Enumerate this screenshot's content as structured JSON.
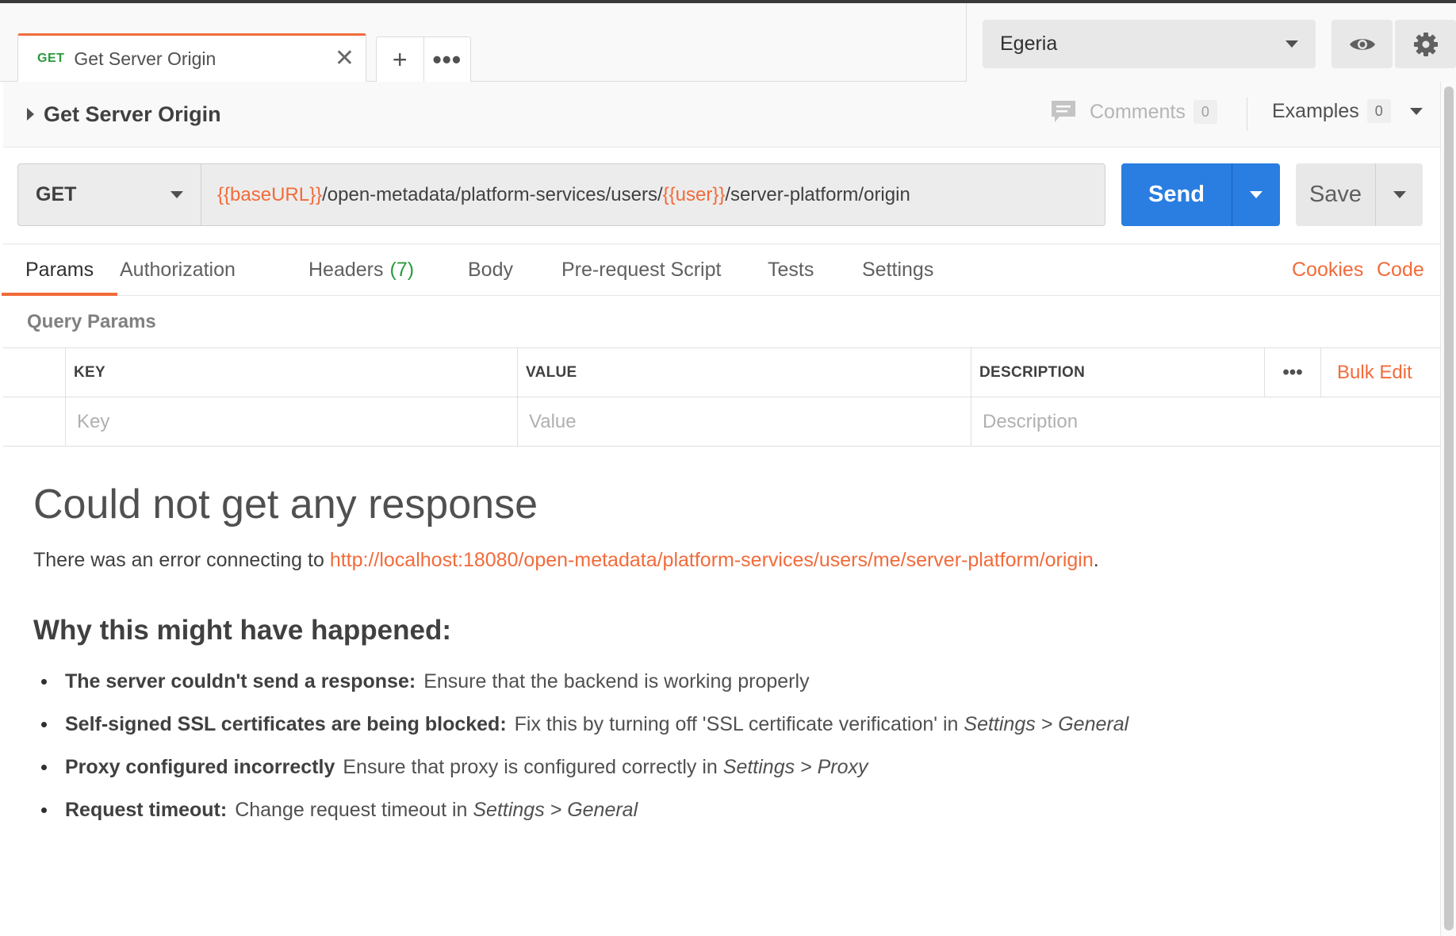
{
  "tabs": [
    {
      "method": "GET",
      "name": "Get Server Origin",
      "close": "✕"
    }
  ],
  "tab_actions": {
    "add": "+",
    "more": "•••"
  },
  "environment": {
    "selected": "Egeria"
  },
  "request": {
    "title": "Get Server Origin",
    "comments_label": "Comments",
    "comments_count": "0",
    "examples_label": "Examples",
    "examples_count": "0",
    "method": "GET",
    "url": {
      "var1": "{{baseURL}}",
      "mid": "/open-metadata/platform-services/users/",
      "var2": "{{user}}",
      "tail": "/server-platform/origin"
    },
    "send_label": "Send",
    "save_label": "Save"
  },
  "subtabs": {
    "params": "Params",
    "authorization": "Authorization",
    "headers": "Headers",
    "headers_count": "(7)",
    "body": "Body",
    "prerequest": "Pre-request Script",
    "tests": "Tests",
    "settings": "Settings",
    "cookies": "Cookies",
    "code": "Code"
  },
  "query_params": {
    "title": "Query Params",
    "col_key": "KEY",
    "col_value": "VALUE",
    "col_description": "DESCRIPTION",
    "more": "•••",
    "bulk_edit": "Bulk Edit",
    "ph_key": "Key",
    "ph_value": "Value",
    "ph_description": "Description"
  },
  "response": {
    "heading": "Could not get any response",
    "error_prefix": "There was an error connecting to ",
    "error_url": "http://localhost:18080/open-metadata/platform-services/users/me/server-platform/origin",
    "error_suffix": ".",
    "why_heading": "Why this might have happened:",
    "reasons": [
      {
        "title": "The server couldn't send a response:",
        "text": "Ensure that the backend is working properly",
        "em": ""
      },
      {
        "title": "Self-signed SSL certificates are being blocked:",
        "text": "Fix this by turning off 'SSL certificate verification' in ",
        "em": "Settings > General"
      },
      {
        "title": "Proxy configured incorrectly",
        "text": "Ensure that proxy is configured correctly in ",
        "em": "Settings > Proxy"
      },
      {
        "title": "Request timeout:",
        "text": "Change request timeout in ",
        "em": "Settings > General"
      }
    ]
  },
  "colors": {
    "accent": "#f26b3a",
    "send": "#2a7de1",
    "get_method": "#2a9a3d"
  },
  "icons": {
    "comments": "comment-icon",
    "eye": "eye-icon",
    "gear": "gear-icon",
    "caret": "caret-down-icon",
    "expand": "triangle-right-icon"
  }
}
